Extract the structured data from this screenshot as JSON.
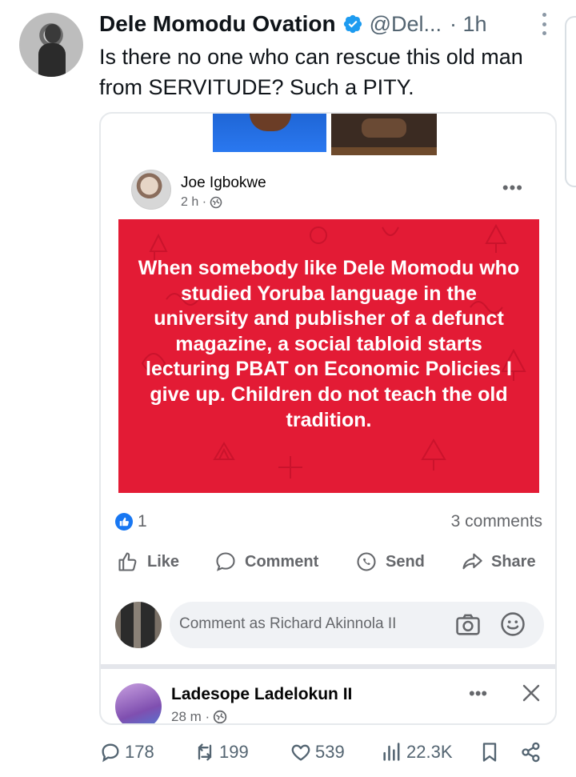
{
  "tweet": {
    "display_name": "Dele Momodu Ovation",
    "handle": "@Del...",
    "time": "· 1h",
    "text": "Is there no one who can rescue this old man from SERVITUDE? Such a PITY.",
    "verified_color": "#1d9bf0"
  },
  "fb_post": {
    "author": "Joe Igbokwe",
    "meta": "2 h ·",
    "quote": "When somebody like Dele Momodu who studied Yoruba language in the university and publisher of a defunct magazine, a social tabloid starts lecturing PBAT on Economic Policies I give up. Children do not teach the old tradition.",
    "post_bg": "#e31b35",
    "likes": "1",
    "comments": "3 comments",
    "actions": {
      "like": "Like",
      "comment": "Comment",
      "send": "Send",
      "share": "Share"
    },
    "comment_placeholder": "Comment as Richard Akinnola II",
    "next_comment": {
      "author": "Ladesope Ladelokun II",
      "meta": "28 m ·"
    }
  },
  "engagement": {
    "replies": "178",
    "reposts": "199",
    "likes": "539",
    "views": "22.3K"
  },
  "icons": [
    "verified-badge-icon",
    "more-icon",
    "like-icon",
    "comment-icon",
    "send-icon",
    "share-icon",
    "camera-icon",
    "smiley-icon",
    "close-icon",
    "reply-icon",
    "repost-icon",
    "heart-icon",
    "views-icon",
    "bookmark-icon",
    "share-network-icon",
    "globe-icon"
  ]
}
